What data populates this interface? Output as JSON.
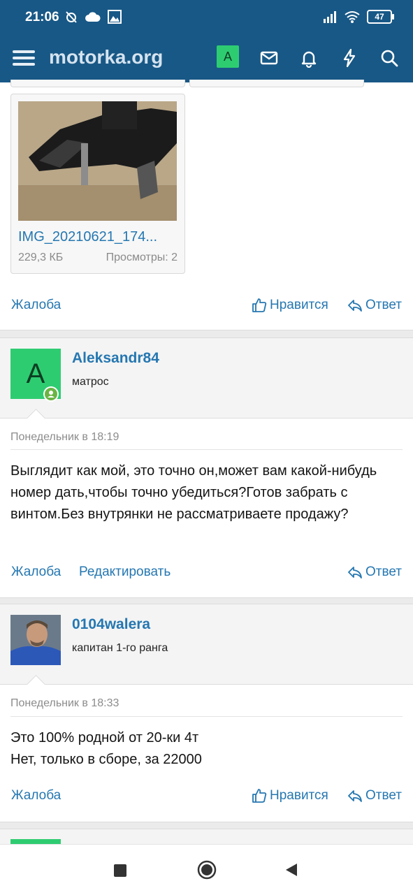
{
  "status_bar": {
    "time": "21:06",
    "battery": "47",
    "icons": [
      "alarm-off-icon",
      "cloud-icon",
      "image-icon",
      "signal-icon",
      "wifi-icon",
      "battery-icon"
    ]
  },
  "header": {
    "title": "motorka.org",
    "avatar_letter": "A",
    "icons": [
      "menu-icon",
      "mail-icon",
      "bell-icon",
      "lightning-icon",
      "search-icon"
    ]
  },
  "attachment": {
    "name": "IMG_20210621_174...",
    "size": "229,3 КБ",
    "views": "Просмотры: 2"
  },
  "post_actions_1": {
    "report": "Жалоба",
    "like": "Нравится",
    "reply": "Ответ"
  },
  "post2": {
    "username": "Aleksandr84",
    "user_title": "матрос",
    "avatar_letter": "A",
    "date": "Понедельник в 18:19",
    "message": "Выглядит как мой, это точно он,может вам какой-нибудь номер дать,чтобы точно убедиться?Готов забрать с винтом.Без внутрянки не рассматриваете продажу?",
    "report": "Жалоба",
    "edit": "Редактировать",
    "reply": "Ответ"
  },
  "post3": {
    "username": "0104walera",
    "user_title": "капитан 1-го ранга",
    "date": "Понедельник в 18:33",
    "message_line1": "Это 100% родной от 20-ки 4т",
    "message_line2": "Нет, только в сборе, за 22000",
    "report": "Жалоба",
    "like": "Нравится",
    "reply": "Ответ"
  },
  "colors": {
    "header": "#185886",
    "link": "#2577b1",
    "avatar_green": "#2ecc71"
  }
}
